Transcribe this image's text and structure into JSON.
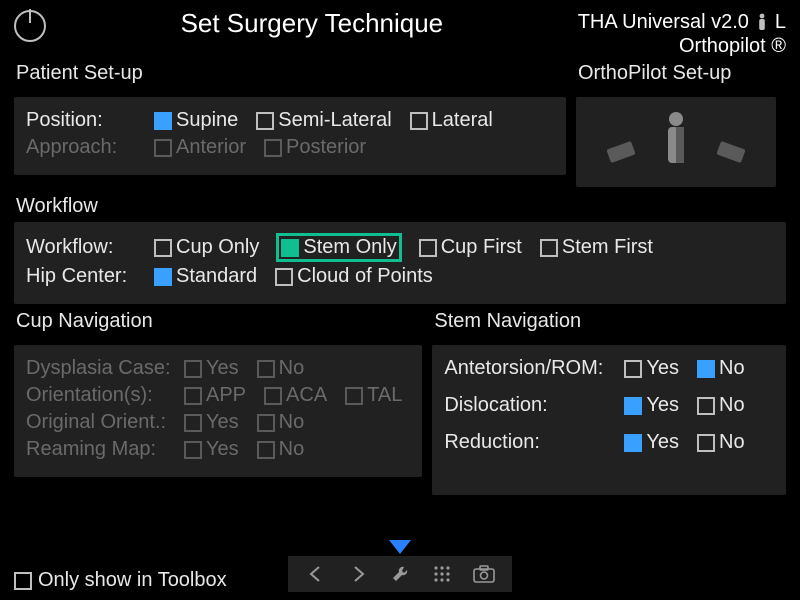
{
  "header": {
    "title": "Set Surgery Technique",
    "version_line1": "THA Universal v2.0",
    "side": "L",
    "brand": "Orthopilot ®"
  },
  "panels": {
    "patient_setup": {
      "title": "Patient Set-up",
      "position_label": "Position:",
      "position_options": {
        "supine": "Supine",
        "semi_lateral": "Semi-Lateral",
        "lateral": "Lateral"
      },
      "approach_label": "Approach:",
      "approach_options": {
        "anterior": "Anterior",
        "posterior": "Posterior"
      }
    },
    "orthopilot_setup": {
      "title": "OrthoPilot Set-up"
    },
    "workflow": {
      "title": "Workflow",
      "workflow_label": "Workflow:",
      "workflow_options": {
        "cup_only": "Cup Only",
        "stem_only": "Stem Only",
        "cup_first": "Cup First",
        "stem_first": "Stem First"
      },
      "hip_center_label": "Hip Center:",
      "hip_center_options": {
        "standard": "Standard",
        "cloud": "Cloud of Points"
      }
    },
    "cup_nav": {
      "title": "Cup Navigation",
      "dysplasia_label": "Dysplasia Case:",
      "orientations_label": "Orientation(s):",
      "orig_orient_label": "Original Orient.:",
      "reaming_label": "Reaming Map:",
      "yes": "Yes",
      "no": "No",
      "app": "APP",
      "aca": "ACA",
      "tal": "TAL"
    },
    "stem_nav": {
      "title": "Stem Navigation",
      "antetorsion_label": "Antetorsion/ROM:",
      "dislocation_label": "Dislocation:",
      "reduction_label": "Reduction:",
      "yes": "Yes",
      "no": "No"
    }
  },
  "footer": {
    "only_toolbox": "Only show in Toolbox"
  }
}
